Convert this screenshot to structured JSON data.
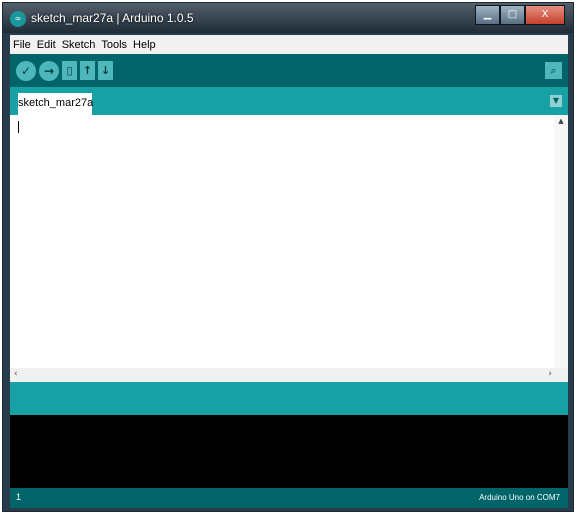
{
  "window": {
    "title": "sketch_mar27a | Arduino 1.0.5",
    "app_icon_text": "∞",
    "controls": {
      "minimize": "▁",
      "maximize": "□",
      "close": "X"
    }
  },
  "menu": [
    "File",
    "Edit",
    "Sketch",
    "Tools",
    "Help"
  ],
  "toolbar": {
    "verify_icon": "✓",
    "upload_icon": "→",
    "new_icon": "▯",
    "open_icon": "↑",
    "save_icon": "↓",
    "serial_monitor_icon": "⌕"
  },
  "tabs": [
    {
      "label": "sketch_mar27a"
    }
  ],
  "tab_menu_icon": "▼",
  "scroll": {
    "up": "▲",
    "left": "‹",
    "right": "›"
  },
  "status": {
    "line": "1",
    "board": "Arduino Uno on COM7"
  },
  "colors": {
    "toolbar": "#006468",
    "tabbar": "#17a1a5",
    "console": "#000000"
  }
}
